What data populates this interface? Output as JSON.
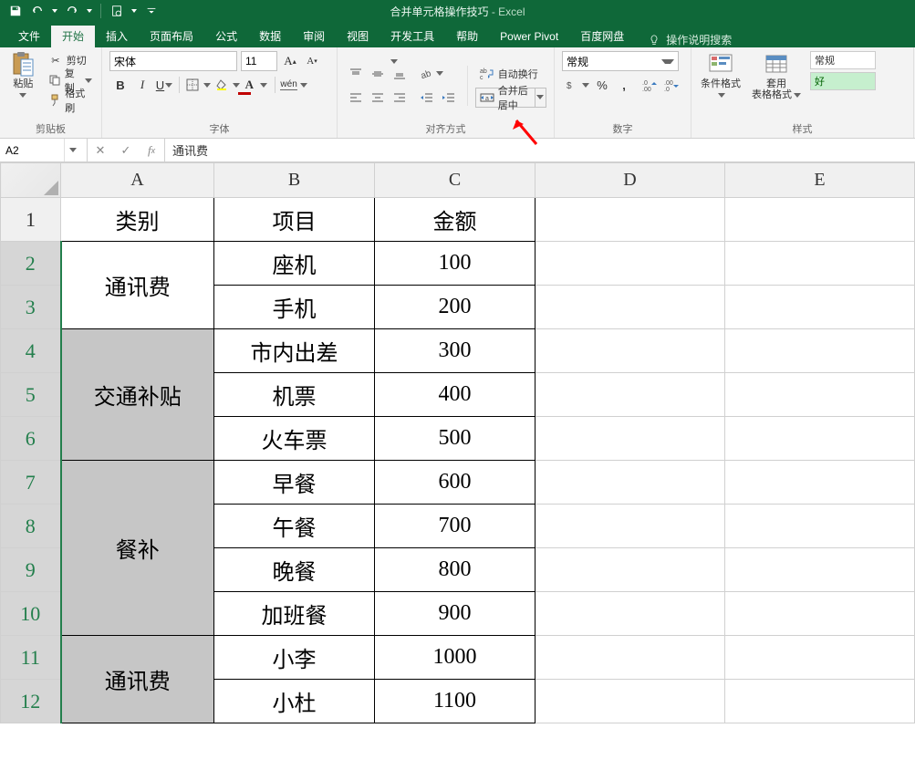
{
  "title": {
    "doc": "合并单元格操作技巧",
    "sep": " - ",
    "app": "Excel"
  },
  "tabs": [
    "文件",
    "开始",
    "插入",
    "页面布局",
    "公式",
    "数据",
    "审阅",
    "视图",
    "开发工具",
    "帮助",
    "Power Pivot",
    "百度网盘"
  ],
  "active_tab_index": 1,
  "tellme": "操作说明搜索",
  "clipboard": {
    "paste": "粘贴",
    "cut": "剪切",
    "copy": "复制",
    "format_painter": "格式刷",
    "group": "剪贴板"
  },
  "font": {
    "name": "宋体",
    "size": "11",
    "group": "字体"
  },
  "alignment": {
    "wrap": "自动换行",
    "merge": "合并后居中",
    "group": "对齐方式"
  },
  "number": {
    "format": "常规",
    "group": "数字"
  },
  "styles": {
    "conditional": "条件格式",
    "table": "套用\n表格格式",
    "normal": "常规",
    "good": "好",
    "group": "样式"
  },
  "formula_bar": {
    "name_box": "A2",
    "value": "通讯费"
  },
  "columns": [
    "A",
    "B",
    "C",
    "D",
    "E"
  ],
  "row_numbers": [
    1,
    2,
    3,
    4,
    5,
    6,
    7,
    8,
    9,
    10,
    11,
    12
  ],
  "headers": {
    "A": "类别",
    "B": "项目",
    "C": "金额"
  },
  "col_a_merged": [
    {
      "start": 2,
      "span": 2,
      "value": "通讯费",
      "active": true
    },
    {
      "start": 4,
      "span": 3,
      "value": "交通补贴"
    },
    {
      "start": 7,
      "span": 4,
      "value": "餐补"
    },
    {
      "start": 11,
      "span": 2,
      "value": "通讯费"
    }
  ],
  "rows_bc": [
    {
      "b": "座机",
      "c": "100"
    },
    {
      "b": "手机",
      "c": "200"
    },
    {
      "b": "市内出差",
      "c": "300"
    },
    {
      "b": "机票",
      "c": "400"
    },
    {
      "b": "火车票",
      "c": "500"
    },
    {
      "b": "早餐",
      "c": "600"
    },
    {
      "b": "午餐",
      "c": "700"
    },
    {
      "b": "晚餐",
      "c": "800"
    },
    {
      "b": "加班餐",
      "c": "900"
    },
    {
      "b": "小李",
      "c": "1000"
    },
    {
      "b": "小杜",
      "c": "1100"
    }
  ],
  "selection": {
    "range": "A2:A12",
    "active": "A2"
  },
  "chart_data": null
}
